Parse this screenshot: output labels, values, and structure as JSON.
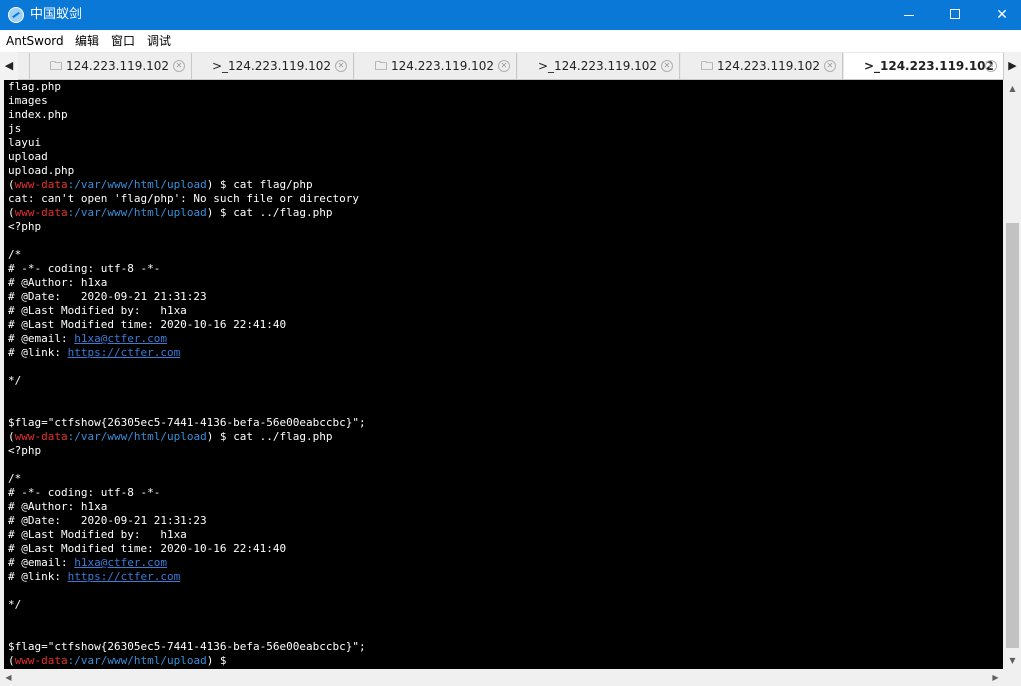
{
  "window": {
    "title": "中国蚁剑",
    "min_glyph": "",
    "close_glyph": "✕"
  },
  "menu": [
    "AntSword",
    "编辑",
    "窗口",
    "调试"
  ],
  "tabs": [
    {
      "icon": "🗀",
      "label": "124.223.119.102",
      "close": "✕"
    },
    {
      "icon": ">_",
      "label": "124.223.119.102",
      "close": "✕"
    },
    {
      "icon": "🗀",
      "label": "124.223.119.102",
      "close": "✕"
    },
    {
      "icon": ">_",
      "label": "124.223.119.102",
      "close": "✕"
    },
    {
      "icon": "🗀",
      "label": "124.223.119.102",
      "close": "✕"
    },
    {
      "icon": ">_",
      "label": "124.223.119.102",
      "close": "✕"
    }
  ],
  "tabbar_arrows": {
    "left": "◀",
    "right": "▶"
  },
  "scroll_arrows": {
    "up": "▲",
    "down": "▼",
    "left": "◀",
    "right": "▶"
  },
  "prompt": {
    "open": "(",
    "user": "www-data",
    "sep": ":",
    "path": "/var/www/html/upload",
    "close": ") $ "
  },
  "terminal_lines": [
    {
      "t": "text",
      "v": "flag.php"
    },
    {
      "t": "text",
      "v": "images"
    },
    {
      "t": "text",
      "v": "index.php"
    },
    {
      "t": "text",
      "v": "js"
    },
    {
      "t": "text",
      "v": "layui"
    },
    {
      "t": "text",
      "v": "upload"
    },
    {
      "t": "text",
      "v": "upload.php"
    },
    {
      "t": "prompt",
      "cmd": "cat flag/php"
    },
    {
      "t": "text",
      "v": "cat: can't open 'flag/php': No such file or directory"
    },
    {
      "t": "prompt",
      "cmd": "cat ../flag.php"
    },
    {
      "t": "text",
      "v": "<?php"
    },
    {
      "t": "text",
      "v": ""
    },
    {
      "t": "text",
      "v": "/*"
    },
    {
      "t": "text",
      "v": "# -*- coding: utf-8 -*-"
    },
    {
      "t": "text",
      "v": "# @Author: h1xa"
    },
    {
      "t": "text",
      "v": "# @Date:   2020-09-21 21:31:23"
    },
    {
      "t": "text",
      "v": "# @Last Modified by:   h1xa"
    },
    {
      "t": "text",
      "v": "# @Last Modified time: 2020-10-16 22:41:40"
    },
    {
      "t": "link",
      "pre": "# @email: ",
      "link": "h1xa@ctfer.com"
    },
    {
      "t": "link",
      "pre": "# @link: ",
      "link": "https://ctfer.com"
    },
    {
      "t": "text",
      "v": ""
    },
    {
      "t": "text",
      "v": "*/"
    },
    {
      "t": "text",
      "v": ""
    },
    {
      "t": "text",
      "v": ""
    },
    {
      "t": "text",
      "v": "$flag=\"ctfshow{26305ec5-7441-4136-befa-56e00eabccbc}\";"
    },
    {
      "t": "prompt",
      "cmd": "cat ../flag.php"
    },
    {
      "t": "text",
      "v": "<?php"
    },
    {
      "t": "text",
      "v": ""
    },
    {
      "t": "text",
      "v": "/*"
    },
    {
      "t": "text",
      "v": "# -*- coding: utf-8 -*-"
    },
    {
      "t": "text",
      "v": "# @Author: h1xa"
    },
    {
      "t": "text",
      "v": "# @Date:   2020-09-21 21:31:23"
    },
    {
      "t": "text",
      "v": "# @Last Modified by:   h1xa"
    },
    {
      "t": "text",
      "v": "# @Last Modified time: 2020-10-16 22:41:40"
    },
    {
      "t": "link",
      "pre": "# @email: ",
      "link": "h1xa@ctfer.com"
    },
    {
      "t": "link",
      "pre": "# @link: ",
      "link": "https://ctfer.com"
    },
    {
      "t": "text",
      "v": ""
    },
    {
      "t": "text",
      "v": "*/"
    },
    {
      "t": "text",
      "v": ""
    },
    {
      "t": "text",
      "v": ""
    },
    {
      "t": "text",
      "v": "$flag=\"ctfshow{26305ec5-7441-4136-befa-56e00eabccbc}\";"
    },
    {
      "t": "prompt",
      "cmd": ""
    }
  ],
  "colors": {
    "titlebar": "#0a78d7",
    "terminal_bg": "#000000",
    "prompt_user": "#e5302e",
    "prompt_path": "#3a8fd8",
    "link": "#3a7bd5"
  }
}
